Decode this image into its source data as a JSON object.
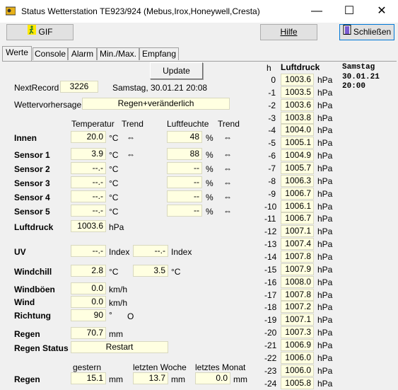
{
  "window": {
    "title": "Status Wetterstation TE923/924 (Mebus,Irox,Honeywell,Cresta)",
    "minimize": "—",
    "maximize": "☐",
    "close": "✕"
  },
  "toolbar": {
    "gif_label": "GIF",
    "help_label": "Hilfe",
    "close_label": "Schließen"
  },
  "tabs": [
    "Werte",
    "Console",
    "Alarm",
    "Min./Max.",
    "Empfang"
  ],
  "update_label": "Update",
  "next_record": {
    "label": "NextRecord",
    "value": "3226",
    "datetime": "Samstag, 30.01.21  20:08"
  },
  "forecast": {
    "label": "Wettervorhersage",
    "value": "Regen+veränderlich"
  },
  "headers": {
    "temperature": "Temperatur",
    "trend1": "Trend",
    "humidity": "Luftfeuchte",
    "trend2": "Trend"
  },
  "sensors": [
    {
      "name": "Innen",
      "temp": "20.0",
      "temp_unit": "°C",
      "temp_trend": "⇔",
      "hum": "48",
      "hum_unit": "%",
      "hum_trend": "⇔"
    },
    {
      "name": "Sensor 1",
      "temp": "3.9",
      "temp_unit": "°C",
      "temp_trend": "⇔",
      "hum": "88",
      "hum_unit": "%",
      "hum_trend": "⇔"
    },
    {
      "name": "Sensor 2",
      "temp": "--.-",
      "temp_unit": "°C",
      "temp_trend": "",
      "hum": "--",
      "hum_unit": "%",
      "hum_trend": "⇔"
    },
    {
      "name": "Sensor 3",
      "temp": "--.-",
      "temp_unit": "°C",
      "temp_trend": "",
      "hum": "--",
      "hum_unit": "%",
      "hum_trend": "⇔"
    },
    {
      "name": "Sensor 4",
      "temp": "--.-",
      "temp_unit": "°C",
      "temp_trend": "",
      "hum": "--",
      "hum_unit": "%",
      "hum_trend": "⇔"
    },
    {
      "name": "Sensor 5",
      "temp": "--.-",
      "temp_unit": "°C",
      "temp_trend": "",
      "hum": "--",
      "hum_unit": "%",
      "hum_trend": "⇔"
    }
  ],
  "pressure": {
    "label": "Luftdruck",
    "value": "1003.6",
    "unit": "hPa"
  },
  "uv": {
    "label": "UV",
    "value": "--.-",
    "unit": "Index",
    "value2": "--.-",
    "unit2": "Index"
  },
  "windchill": {
    "label": "Windchill",
    "value": "2.8",
    "unit": "°C",
    "value2": "3.5",
    "unit2": "°C"
  },
  "gusts": {
    "label": "Windböen",
    "value": "0.0",
    "unit": "km/h"
  },
  "wind": {
    "label": "Wind",
    "value": "0.0",
    "unit": "km/h"
  },
  "direction": {
    "label": "Richtung",
    "value": "90",
    "unit": "°",
    "compass": "O"
  },
  "rain": {
    "label": "Regen",
    "value": "70.7",
    "unit": "mm"
  },
  "rain_status": {
    "label": "Regen Status",
    "value": "Restart"
  },
  "rain_period": {
    "label": "Regen",
    "h_yesterday": "gestern",
    "h_week": "letzten  Woche",
    "h_month": "letztes Monat",
    "yesterday": "15.1",
    "week": "13.7",
    "month": "0.0",
    "unit": "mm"
  },
  "history": {
    "h_label": "h",
    "title": "Luftdruck",
    "unit": "hPa",
    "day": "Samstag",
    "date": "30.01.21",
    "time": "20:00",
    "rows": [
      {
        "h": "0",
        "v": "1003.6"
      },
      {
        "h": "-1",
        "v": "1003.5"
      },
      {
        "h": "-2",
        "v": "1003.6"
      },
      {
        "h": "-3",
        "v": "1003.8"
      },
      {
        "h": "-4",
        "v": "1004.0"
      },
      {
        "h": "-5",
        "v": "1005.1"
      },
      {
        "h": "-6",
        "v": "1004.9"
      },
      {
        "h": "-7",
        "v": "1005.7"
      },
      {
        "h": "-8",
        "v": "1006.3"
      },
      {
        "h": "-9",
        "v": "1006.7"
      },
      {
        "h": "-10",
        "v": "1006.1"
      },
      {
        "h": "-11",
        "v": "1006.7"
      },
      {
        "h": "-12",
        "v": "1007.1"
      },
      {
        "h": "-13",
        "v": "1007.4"
      },
      {
        "h": "-14",
        "v": "1007.8"
      },
      {
        "h": "-15",
        "v": "1007.9"
      },
      {
        "h": "-16",
        "v": "1008.0"
      },
      {
        "h": "-17",
        "v": "1007.8"
      },
      {
        "h": "-18",
        "v": "1007.2"
      },
      {
        "h": "-19",
        "v": "1007.1"
      },
      {
        "h": "-20",
        "v": "1007.3"
      },
      {
        "h": "-21",
        "v": "1006.9"
      },
      {
        "h": "-22",
        "v": "1006.0"
      },
      {
        "h": "-23",
        "v": "1006.0"
      },
      {
        "h": "-24",
        "v": "1005.8"
      }
    ]
  }
}
